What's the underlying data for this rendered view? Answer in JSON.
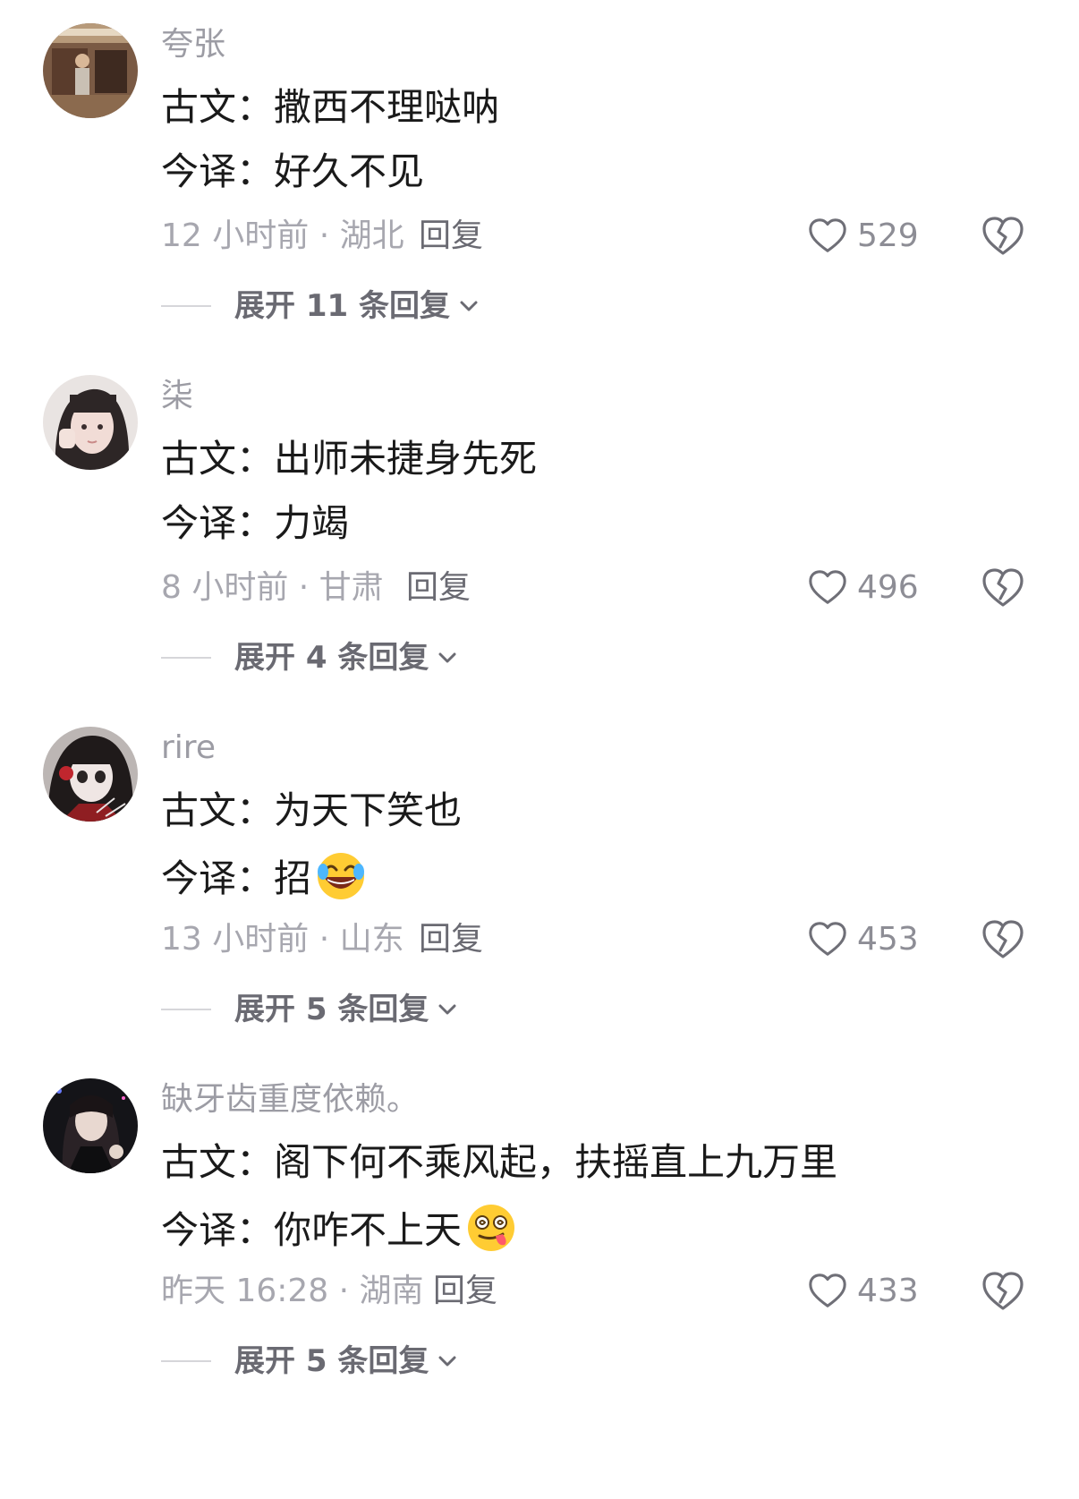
{
  "comments": [
    {
      "username": "夸张",
      "original_prefix": "古文：",
      "original_text": "撒西不理哒呐",
      "translation_prefix": "今译：",
      "translation_text": "好久不见",
      "translation_emoji": "",
      "time_location": "12 小时前 · 湖北",
      "reply_label": "回复",
      "likes": "529",
      "expand_label": "展开 11 条回复"
    },
    {
      "username": "柒",
      "original_prefix": "古文：",
      "original_text": "出师未捷身先死",
      "translation_prefix": "今译：",
      "translation_text": "力竭",
      "translation_emoji": "",
      "time_location": "8 小时前 · 甘肃",
      "reply_label": "回复",
      "likes": "496",
      "expand_label": "展开 4 条回复"
    },
    {
      "username": "rire",
      "original_prefix": "古文：",
      "original_text": "为天下笑也",
      "translation_prefix": "今译：",
      "translation_text": "招",
      "translation_emoji": "rolling-laughing-emoji",
      "time_location": "13 小时前 · 山东",
      "reply_label": "回复",
      "likes": "453",
      "expand_label": "展开 5 条回复"
    },
    {
      "username": "缺牙齿重度依赖。",
      "original_prefix": "古文：",
      "original_text": "阁下何不乘风起，扶摇直上九万里",
      "translation_prefix": "今译：",
      "translation_text": "你咋不上天",
      "translation_emoji": "dizzy-tongue-emoji",
      "time_location": "昨天 16:28 · 湖南",
      "reply_label": "回复",
      "likes": "433",
      "expand_label": "展开 5 条回复"
    }
  ],
  "icons": {
    "like": "heart-outline-icon",
    "dislike": "broken-heart-icon",
    "expand": "chevron-down-icon"
  },
  "colors": {
    "text": "#1a1a1a",
    "secondary": "#a7a7af",
    "username": "#9c9ca4"
  }
}
